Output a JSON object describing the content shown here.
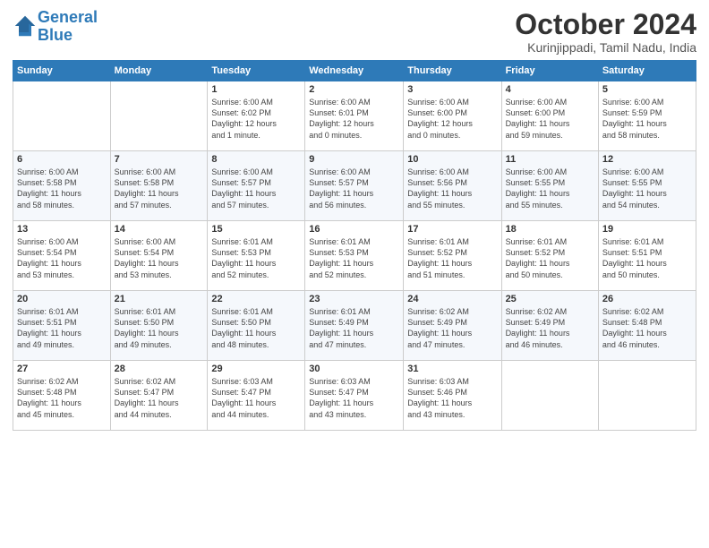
{
  "header": {
    "logo_line1": "General",
    "logo_line2": "Blue",
    "month_title": "October 2024",
    "location": "Kurinjippadi, Tamil Nadu, India"
  },
  "days_of_week": [
    "Sunday",
    "Monday",
    "Tuesday",
    "Wednesday",
    "Thursday",
    "Friday",
    "Saturday"
  ],
  "weeks": [
    [
      {
        "day": "",
        "info": ""
      },
      {
        "day": "",
        "info": ""
      },
      {
        "day": "1",
        "info": "Sunrise: 6:00 AM\nSunset: 6:02 PM\nDaylight: 12 hours\nand 1 minute."
      },
      {
        "day": "2",
        "info": "Sunrise: 6:00 AM\nSunset: 6:01 PM\nDaylight: 12 hours\nand 0 minutes."
      },
      {
        "day": "3",
        "info": "Sunrise: 6:00 AM\nSunset: 6:00 PM\nDaylight: 12 hours\nand 0 minutes."
      },
      {
        "day": "4",
        "info": "Sunrise: 6:00 AM\nSunset: 6:00 PM\nDaylight: 11 hours\nand 59 minutes."
      },
      {
        "day": "5",
        "info": "Sunrise: 6:00 AM\nSunset: 5:59 PM\nDaylight: 11 hours\nand 58 minutes."
      }
    ],
    [
      {
        "day": "6",
        "info": "Sunrise: 6:00 AM\nSunset: 5:58 PM\nDaylight: 11 hours\nand 58 minutes."
      },
      {
        "day": "7",
        "info": "Sunrise: 6:00 AM\nSunset: 5:58 PM\nDaylight: 11 hours\nand 57 minutes."
      },
      {
        "day": "8",
        "info": "Sunrise: 6:00 AM\nSunset: 5:57 PM\nDaylight: 11 hours\nand 57 minutes."
      },
      {
        "day": "9",
        "info": "Sunrise: 6:00 AM\nSunset: 5:57 PM\nDaylight: 11 hours\nand 56 minutes."
      },
      {
        "day": "10",
        "info": "Sunrise: 6:00 AM\nSunset: 5:56 PM\nDaylight: 11 hours\nand 55 minutes."
      },
      {
        "day": "11",
        "info": "Sunrise: 6:00 AM\nSunset: 5:55 PM\nDaylight: 11 hours\nand 55 minutes."
      },
      {
        "day": "12",
        "info": "Sunrise: 6:00 AM\nSunset: 5:55 PM\nDaylight: 11 hours\nand 54 minutes."
      }
    ],
    [
      {
        "day": "13",
        "info": "Sunrise: 6:00 AM\nSunset: 5:54 PM\nDaylight: 11 hours\nand 53 minutes."
      },
      {
        "day": "14",
        "info": "Sunrise: 6:00 AM\nSunset: 5:54 PM\nDaylight: 11 hours\nand 53 minutes."
      },
      {
        "day": "15",
        "info": "Sunrise: 6:01 AM\nSunset: 5:53 PM\nDaylight: 11 hours\nand 52 minutes."
      },
      {
        "day": "16",
        "info": "Sunrise: 6:01 AM\nSunset: 5:53 PM\nDaylight: 11 hours\nand 52 minutes."
      },
      {
        "day": "17",
        "info": "Sunrise: 6:01 AM\nSunset: 5:52 PM\nDaylight: 11 hours\nand 51 minutes."
      },
      {
        "day": "18",
        "info": "Sunrise: 6:01 AM\nSunset: 5:52 PM\nDaylight: 11 hours\nand 50 minutes."
      },
      {
        "day": "19",
        "info": "Sunrise: 6:01 AM\nSunset: 5:51 PM\nDaylight: 11 hours\nand 50 minutes."
      }
    ],
    [
      {
        "day": "20",
        "info": "Sunrise: 6:01 AM\nSunset: 5:51 PM\nDaylight: 11 hours\nand 49 minutes."
      },
      {
        "day": "21",
        "info": "Sunrise: 6:01 AM\nSunset: 5:50 PM\nDaylight: 11 hours\nand 49 minutes."
      },
      {
        "day": "22",
        "info": "Sunrise: 6:01 AM\nSunset: 5:50 PM\nDaylight: 11 hours\nand 48 minutes."
      },
      {
        "day": "23",
        "info": "Sunrise: 6:01 AM\nSunset: 5:49 PM\nDaylight: 11 hours\nand 47 minutes."
      },
      {
        "day": "24",
        "info": "Sunrise: 6:02 AM\nSunset: 5:49 PM\nDaylight: 11 hours\nand 47 minutes."
      },
      {
        "day": "25",
        "info": "Sunrise: 6:02 AM\nSunset: 5:49 PM\nDaylight: 11 hours\nand 46 minutes."
      },
      {
        "day": "26",
        "info": "Sunrise: 6:02 AM\nSunset: 5:48 PM\nDaylight: 11 hours\nand 46 minutes."
      }
    ],
    [
      {
        "day": "27",
        "info": "Sunrise: 6:02 AM\nSunset: 5:48 PM\nDaylight: 11 hours\nand 45 minutes."
      },
      {
        "day": "28",
        "info": "Sunrise: 6:02 AM\nSunset: 5:47 PM\nDaylight: 11 hours\nand 44 minutes."
      },
      {
        "day": "29",
        "info": "Sunrise: 6:03 AM\nSunset: 5:47 PM\nDaylight: 11 hours\nand 44 minutes."
      },
      {
        "day": "30",
        "info": "Sunrise: 6:03 AM\nSunset: 5:47 PM\nDaylight: 11 hours\nand 43 minutes."
      },
      {
        "day": "31",
        "info": "Sunrise: 6:03 AM\nSunset: 5:46 PM\nDaylight: 11 hours\nand 43 minutes."
      },
      {
        "day": "",
        "info": ""
      },
      {
        "day": "",
        "info": ""
      }
    ]
  ]
}
